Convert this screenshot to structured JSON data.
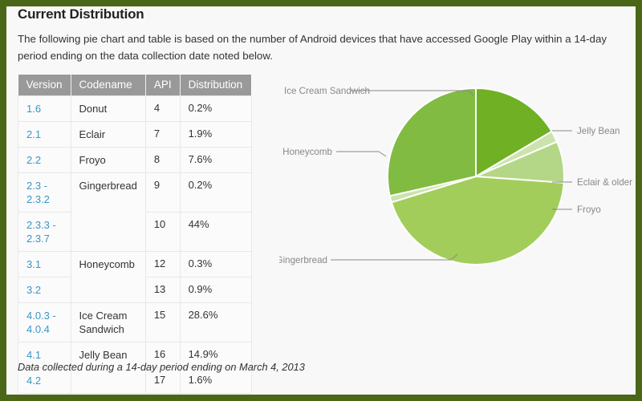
{
  "page": {
    "title": "Current Distribution",
    "intro": "The following pie chart and table is based on the number of Android devices that have accessed Google Play within a 14-day period ending on the data collection date noted below.",
    "footnote": "Data collected during a 14-day period ending on March 4, 2013",
    "border_color": "#4a6617",
    "background_color": "#f8f8f8",
    "link_color": "#3b96c4",
    "header_bg_color": "#999999"
  },
  "table": {
    "columns": [
      "Version",
      "Codename",
      "API",
      "Distribution"
    ],
    "rows": [
      {
        "version": "1.6",
        "codename": "Donut",
        "api": "4",
        "distribution": "0.2%"
      },
      {
        "version": "2.1",
        "codename": "Eclair",
        "api": "7",
        "distribution": "1.9%"
      },
      {
        "version": "2.2",
        "codename": "Froyo",
        "api": "8",
        "distribution": "7.6%"
      },
      {
        "version": "2.3 -\n2.3.2",
        "codename": "Gingerbread",
        "api": "9",
        "distribution": "0.2%"
      },
      {
        "version": "2.3.3 -\n2.3.7",
        "codename": "",
        "api": "10",
        "distribution": "44%"
      },
      {
        "version": "3.1",
        "codename": "Honeycomb",
        "api": "12",
        "distribution": "0.3%"
      },
      {
        "version": "3.2",
        "codename": "",
        "api": "13",
        "distribution": "0.9%"
      },
      {
        "version": "4.0.3 -\n4.0.4",
        "codename": "Ice Cream\nSandwich",
        "api": "15",
        "distribution": "28.6%"
      },
      {
        "version": "4.1",
        "codename": "Jelly Bean",
        "api": "16",
        "distribution": "14.9%"
      },
      {
        "version": "4.2",
        "codename": "",
        "api": "17",
        "distribution": "1.6%"
      }
    ]
  },
  "chart_data": {
    "type": "pie",
    "title": "",
    "legend_position": "callout-labels",
    "grid": false,
    "unit": "%",
    "categories": [
      "Jelly Bean",
      "Eclair & older",
      "Froyo",
      "Gingerbread",
      "Honeycomb",
      "Ice Cream Sandwich"
    ],
    "values": [
      16.5,
      2.1,
      7.6,
      44.2,
      1.2,
      28.6
    ],
    "colors": [
      "#6fb024",
      "#cde3ae",
      "#b4d687",
      "#a2cd5a",
      "#cde3ae",
      "#81bb42"
    ],
    "slices": [
      {
        "label": "Jelly Bean",
        "value": 16.5,
        "color": "#6fb024"
      },
      {
        "label": "Eclair & older",
        "value": 2.1,
        "color": "#cde3ae"
      },
      {
        "label": "Froyo",
        "value": 7.6,
        "color": "#b4d687"
      },
      {
        "label": "Gingerbread",
        "value": 44.2,
        "color": "#a2cd5a"
      },
      {
        "label": "Honeycomb",
        "value": 1.2,
        "color": "#cde3ae"
      },
      {
        "label": "Ice Cream Sandwich",
        "value": 28.6,
        "color": "#81bb42"
      }
    ],
    "labels": {
      "ice_cream_sandwich": "Ice Cream Sandwich",
      "honeycomb": "Honeycomb",
      "gingerbread": "Gingerbread",
      "jelly_bean": "Jelly Bean",
      "eclair_older": "Eclair & older",
      "froyo": "Froyo"
    }
  }
}
